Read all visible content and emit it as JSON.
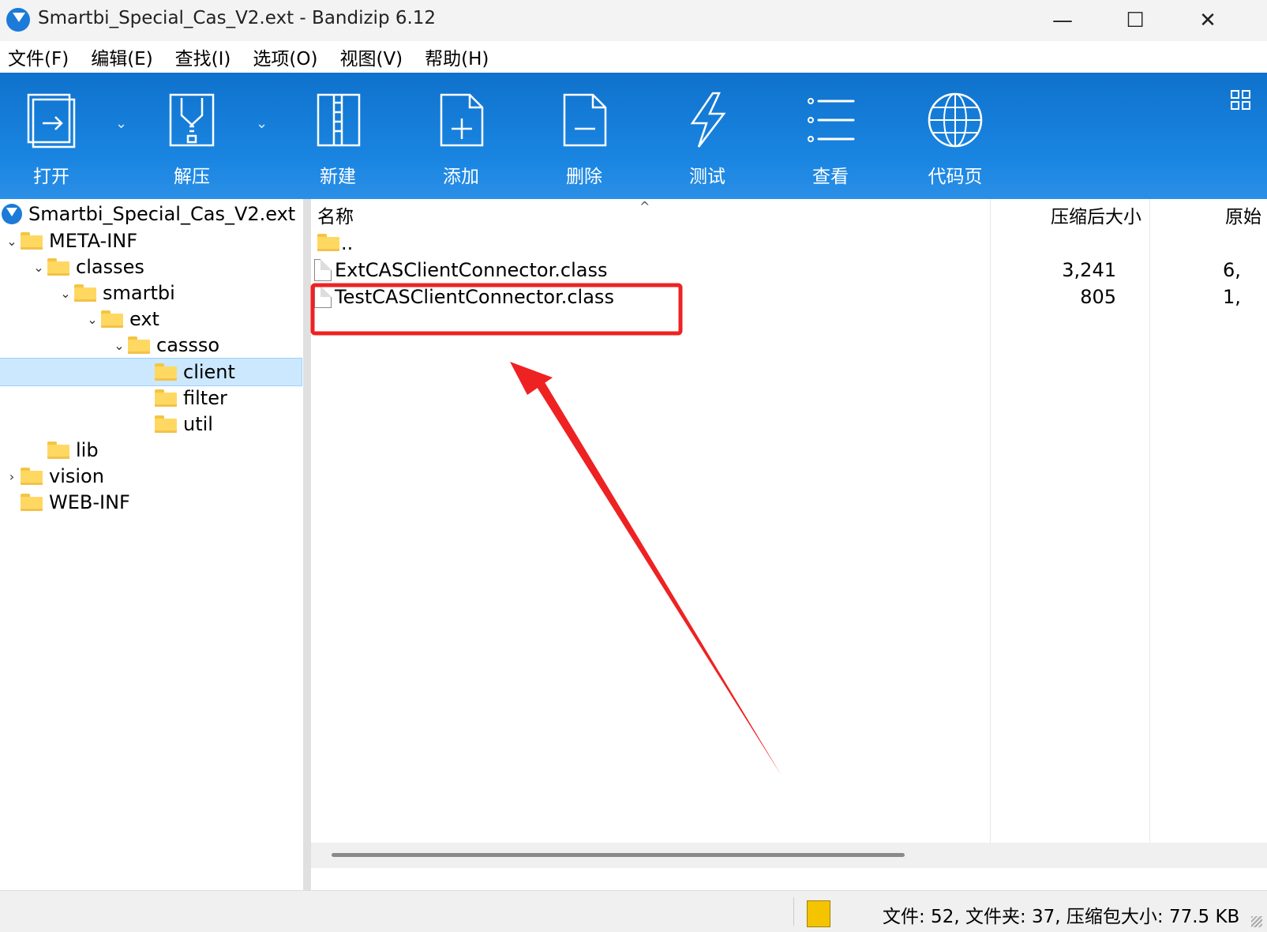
{
  "window": {
    "title": "Smartbi_Special_Cas_V2.ext - Bandizip 6.12",
    "minimize": "—",
    "maximize": "☐",
    "close": "✕"
  },
  "menu": [
    "文件(F)",
    "编辑(E)",
    "查找(I)",
    "选项(O)",
    "视图(V)",
    "帮助(H)"
  ],
  "toolbar": {
    "open": "打开",
    "extract": "解压",
    "new": "新建",
    "add": "添加",
    "delete": "删除",
    "test": "测试",
    "view": "查看",
    "codepage": "代码页"
  },
  "tree": {
    "root": "Smartbi_Special_Cas_V2.ext",
    "items": [
      {
        "label": "META-INF"
      },
      {
        "label": "classes"
      },
      {
        "label": "smartbi"
      },
      {
        "label": "ext"
      },
      {
        "label": "cassso"
      },
      {
        "label": "client"
      },
      {
        "label": "filter"
      },
      {
        "label": "util"
      },
      {
        "label": "lib"
      },
      {
        "label": "vision"
      },
      {
        "label": "WEB-INF"
      }
    ]
  },
  "list": {
    "columns": {
      "name": "名称",
      "packed": "压缩后大小",
      "orig": "原始"
    },
    "parent": "..",
    "rows": [
      {
        "name": "ExtCASClientConnector.class",
        "packed": "3,241",
        "orig": "6,"
      },
      {
        "name": "TestCASClientConnector.class",
        "packed": "805",
        "orig": "1,"
      }
    ]
  },
  "status": {
    "text": "文件: 52, 文件夹: 37, 压缩包大小: 77.5 KB"
  },
  "colors": {
    "toolbar": "#1a86e2",
    "highlight": "#ee2222",
    "selection": "#cce8ff"
  }
}
